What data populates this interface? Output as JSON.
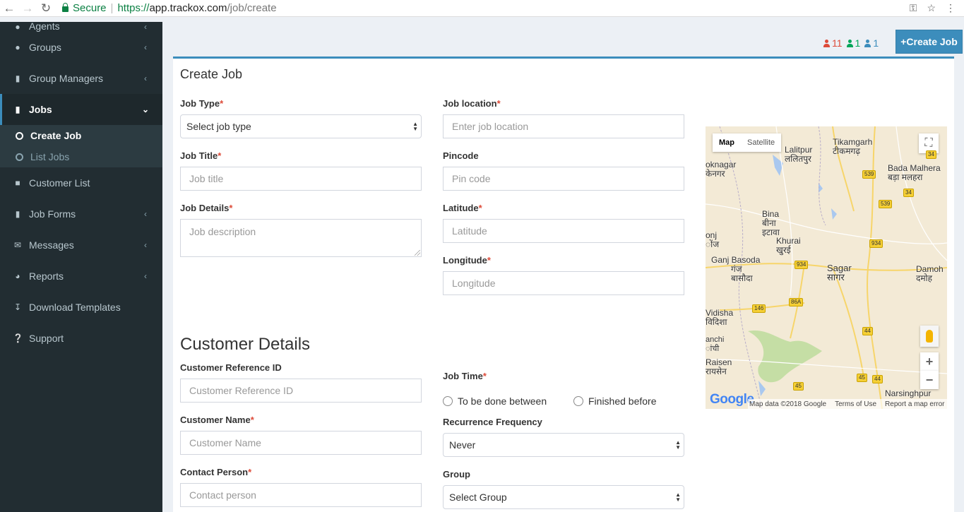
{
  "browser": {
    "secure_label": "Secure",
    "url_protocol": "https://",
    "url_host": "app.trackox.com",
    "url_path": "/job/create"
  },
  "sidebar": {
    "items": [
      {
        "label": "Agents",
        "icon": "user-icon"
      },
      {
        "label": "Groups",
        "icon": "users-icon"
      },
      {
        "label": "Group Managers",
        "icon": "book-icon"
      },
      {
        "label": "Jobs",
        "icon": "book-icon"
      },
      {
        "label": "Customer List",
        "icon": "briefcase-icon"
      },
      {
        "label": "Job Forms",
        "icon": "book-icon"
      },
      {
        "label": "Messages",
        "icon": "envelope-icon"
      },
      {
        "label": "Reports",
        "icon": "pie-chart-icon"
      },
      {
        "label": "Download Templates",
        "icon": "download-icon"
      },
      {
        "label": "Support",
        "icon": "question-circle-icon"
      }
    ],
    "jobs_submenu": [
      {
        "label": "Create Job"
      },
      {
        "label": "List Jobs"
      }
    ]
  },
  "counts": {
    "red": "11",
    "green": "1",
    "blue": "1",
    "red_color": "#dd4b39",
    "green_color": "#00a65a",
    "blue_color": "#3c8dbc"
  },
  "create_job_button": "+Create Job",
  "form": {
    "title": "Create Job",
    "job_type": {
      "label": "Job Type",
      "value": "Select job type"
    },
    "job_title": {
      "label": "Job Title",
      "placeholder": "Job title"
    },
    "job_details": {
      "label": "Job Details",
      "placeholder": "Job description"
    },
    "job_location": {
      "label": "Job location",
      "placeholder": "Enter job location"
    },
    "pincode": {
      "label": "Pincode",
      "placeholder": "Pin code"
    },
    "latitude": {
      "label": "Latitude",
      "placeholder": "Latitude"
    },
    "longitude": {
      "label": "Longitude",
      "placeholder": "Longitude"
    },
    "required_mark": "*"
  },
  "customer": {
    "heading": "Customer Details",
    "reference_id": {
      "label": "Customer Reference ID",
      "placeholder": "Customer Reference ID"
    },
    "name": {
      "label": "Customer Name",
      "placeholder": "Customer Name"
    },
    "contact_person": {
      "label": "Contact Person",
      "placeholder": "Contact person"
    },
    "job_time": {
      "label": "Job Time",
      "options": [
        "To be done between",
        "Finished before"
      ]
    },
    "recurrence": {
      "label": "Recurrence Frequency",
      "value": "Never"
    },
    "group": {
      "label": "Group",
      "value": "Select Group"
    }
  },
  "map": {
    "type_buttons": [
      "Map",
      "Satellite"
    ],
    "cities": [
      "Tikamgarh",
      "टीकमगढ़",
      "Lalitpur",
      "ललितपुर",
      "oknagar",
      "केनगर",
      "Bada Malhera",
      "बड़ा मलहरा",
      "Bina",
      "बीना",
      "इटावा",
      "onj",
      "ोंज",
      "Khurai",
      "खुरई",
      "Ganj Basoda",
      "गंज",
      "बासौदा",
      "Sagar",
      "सागर",
      "Damoh",
      "दमोह",
      "Vidisha",
      "विदिशा",
      "anchi",
      "ांची",
      "Raisen",
      "रायसेन",
      "Narsinghpur"
    ],
    "highways": [
      "34",
      "539",
      "34",
      "539",
      "934",
      "934",
      "146",
      "86A",
      "44",
      "45",
      "44",
      "45"
    ],
    "footer": [
      "Map data ©2018 Google",
      "Terms of Use",
      "Report a map error"
    ],
    "logo": "Google"
  }
}
